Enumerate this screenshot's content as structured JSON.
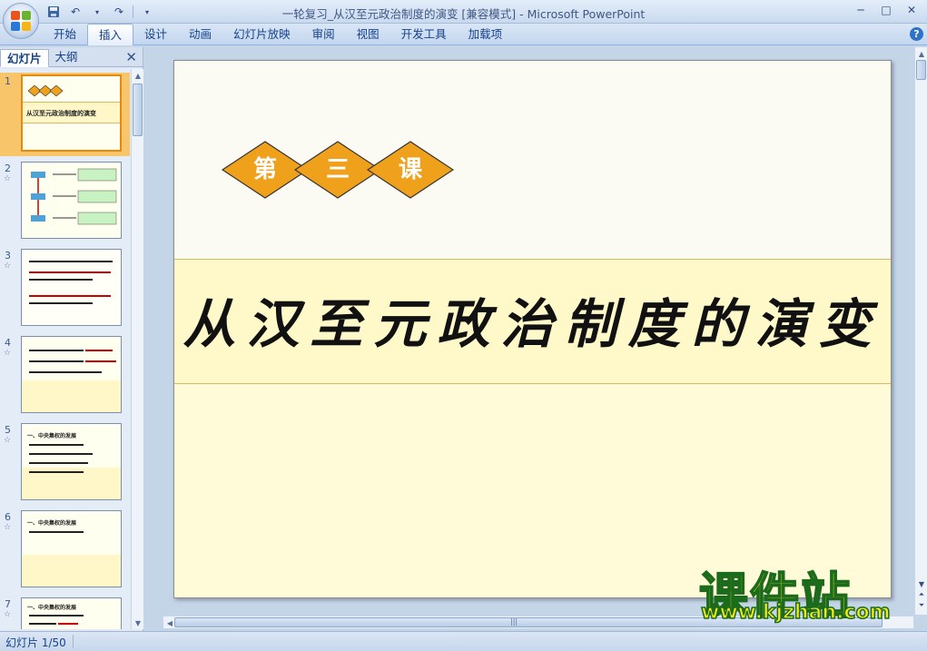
{
  "window": {
    "title": "一轮复习_从汉至元政治制度的演变 [兼容模式] - Microsoft PowerPoint",
    "controls": [
      "minimize",
      "maximize",
      "close"
    ]
  },
  "qat": {
    "save_icon": "save-icon",
    "undo_icon": "undo-icon",
    "redo_icon": "redo-icon"
  },
  "ribbon": {
    "tabs": [
      {
        "label": "开始",
        "active": false
      },
      {
        "label": "插入",
        "active": true
      },
      {
        "label": "设计",
        "active": false
      },
      {
        "label": "动画",
        "active": false
      },
      {
        "label": "幻灯片放映",
        "active": false
      },
      {
        "label": "审阅",
        "active": false
      },
      {
        "label": "视图",
        "active": false
      },
      {
        "label": "开发工具",
        "active": false
      },
      {
        "label": "加载项",
        "active": false
      }
    ],
    "help": "?"
  },
  "panel": {
    "tabs": [
      {
        "label": "幻灯片",
        "active": true
      },
      {
        "label": "大纲",
        "active": false
      }
    ],
    "close": "✕",
    "thumbnails": [
      {
        "num": "1",
        "star": "",
        "selected": true,
        "text": "从汉至元政治制度的演变"
      },
      {
        "num": "2",
        "star": "☆",
        "selected": false
      },
      {
        "num": "3",
        "star": "☆",
        "selected": false
      },
      {
        "num": "4",
        "star": "☆",
        "selected": false
      },
      {
        "num": "5",
        "star": "☆",
        "selected": false,
        "heading": "一、中央集权的发展"
      },
      {
        "num": "6",
        "star": "☆",
        "selected": false,
        "heading": "一、中央集权的发展"
      },
      {
        "num": "7",
        "star": "☆",
        "selected": false,
        "heading": "一、中央集权的发展"
      }
    ]
  },
  "slide": {
    "diamonds": [
      "第",
      "三",
      "课"
    ],
    "title": "从汉至元政治制度的演变",
    "colors": {
      "diamond": "#f0a11c",
      "band": "#fff8c9",
      "band_border": "#d8b860"
    }
  },
  "watermark": {
    "brand": "课件站",
    "url": "www.kjzhan.com"
  },
  "status": {
    "slide_info": "幻灯片 1/50"
  }
}
